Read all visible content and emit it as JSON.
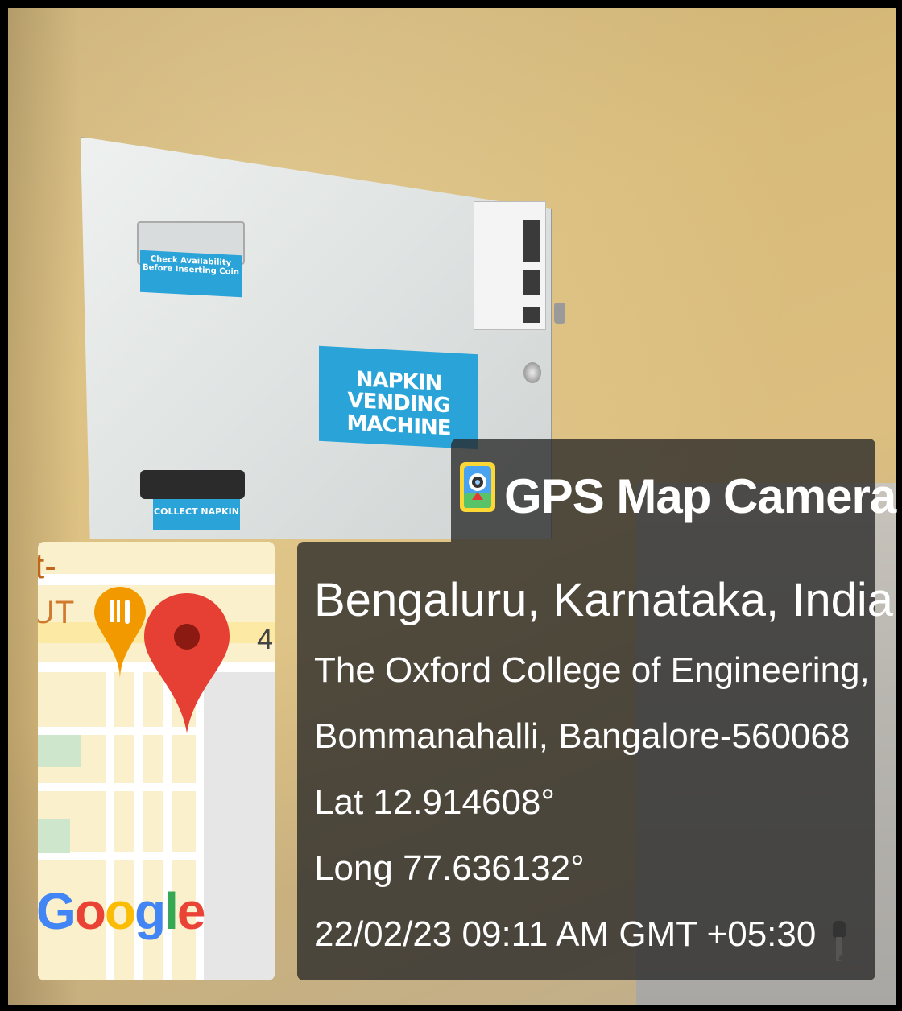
{
  "photo": {
    "machine_labels": {
      "check": "Check Availability Before Inserting Coin",
      "title": "NAPKIN VENDING MACHINE",
      "collect": "COLLECT NAPKIN"
    }
  },
  "map": {
    "partial_top": "t-",
    "partial_ut": "UT",
    "partial_4": "4",
    "google_letters": [
      "G",
      "o",
      "o",
      "g",
      "l",
      "e"
    ],
    "pins": [
      "red-location-pin-icon",
      "orange-restaurant-pin-icon"
    ]
  },
  "overlay": {
    "app_title": "GPS Map Camera",
    "location": "Bengaluru, Karnataka, India",
    "address_line1": "The Oxford College of Engineering,",
    "address_line2": "Bommanahalli, Bangalore-560068",
    "latitude": "Lat 12.914608°",
    "longitude": "Long 77.636132°",
    "timestamp": "22/02/23 09:11 AM GMT +05:30"
  },
  "colors": {
    "wall": "#d8bb7a",
    "label_blue": "#2aa3d8",
    "overlay_bg": "#282828",
    "pin_red": "#E54033",
    "pin_orange": "#F29900"
  }
}
